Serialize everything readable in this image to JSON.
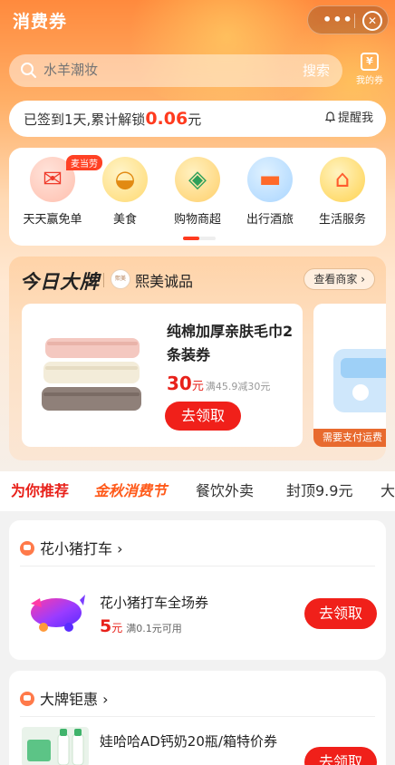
{
  "app": {
    "title": "消费券"
  },
  "capsule": {
    "more": "•••"
  },
  "search": {
    "placeholder": "水羊潮妆",
    "button": "搜索"
  },
  "my_coupons": {
    "label": "我的券"
  },
  "signin": {
    "prefix": "已签到1天,累计解锁",
    "amount": "0.06",
    "suffix": "元",
    "remind": "提醒我"
  },
  "categories": [
    {
      "label": "天天赢免单",
      "icon": "red-envelope-icon",
      "badge": "麦当劳"
    },
    {
      "label": "美食",
      "icon": "noodle-bowl-icon"
    },
    {
      "label": "购物商超",
      "icon": "shopping-basket-icon"
    },
    {
      "label": "出行酒旅",
      "icon": "car-icon"
    },
    {
      "label": "生活服务",
      "icon": "house-icon"
    }
  ],
  "brand_today": {
    "title": "今日大牌",
    "brand_name": "熙美诚品",
    "view_merchant": "查看商家",
    "product": {
      "name": "纯棉加厚亲肤毛巾2条装券",
      "price": "30",
      "unit": "元",
      "condition": "满45.9减30元",
      "button": "去领取"
    },
    "next_card_strip": "需要支付运费"
  },
  "tabs": [
    {
      "label": "为你推荐",
      "active": true
    },
    {
      "label": "金秋消费节",
      "fest": true
    },
    {
      "label": "餐饮外卖"
    },
    {
      "label": "封顶9.9元"
    },
    {
      "label": "大"
    }
  ],
  "feed": [
    {
      "section": "花小猪打车",
      "item": {
        "name": "花小猪打车全场券",
        "price": "5",
        "unit": "元",
        "condition": "满0.1元可用",
        "button": "去领取"
      }
    },
    {
      "section": "大牌钜惠",
      "item": {
        "name": "娃哈哈AD钙奶20瓶/箱特价券",
        "button": "去领取"
      }
    }
  ],
  "colors": {
    "accent": "#f0201a",
    "hero_top": "#ff8a3d"
  }
}
